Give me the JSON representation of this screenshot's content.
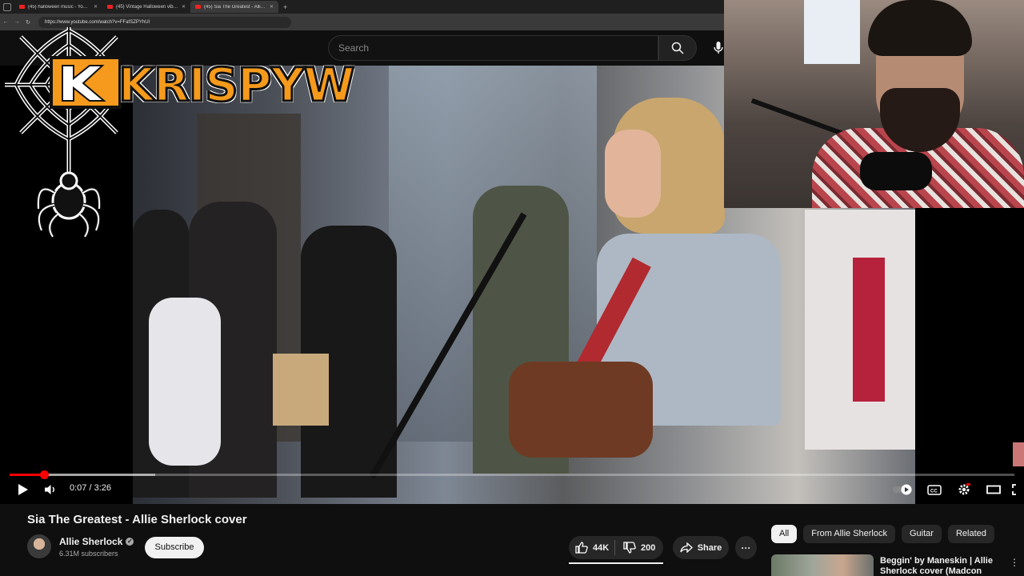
{
  "browser": {
    "tabs": [
      {
        "label": "(45) halloween music - YouTube",
        "active": false
      },
      {
        "label": "(45) Vintage Halloween vibes 🎃",
        "active": false
      },
      {
        "label": "(45) Sia The Greatest - Allie Sherl…",
        "active": true
      }
    ],
    "url": "https://www.youtube.com/watch?v=FFafSZPYhUI"
  },
  "header": {
    "search_placeholder": "Search"
  },
  "overlay": {
    "logo_text": "KRISPYW"
  },
  "player": {
    "time": "0:07 / 3:26",
    "played_fraction": 0.034,
    "buffered_fraction": 0.145
  },
  "video": {
    "title": "Sia The Greatest - Allie Sherlock cover",
    "channel": "Allie Sherlock",
    "subscribers": "6.31M subscribers",
    "subscribe_label": "Subscribe",
    "likes": "44K",
    "dislikes": "200",
    "share_label": "Share"
  },
  "sidebar": {
    "chips": [
      {
        "label": "All",
        "selected": true
      },
      {
        "label": "From Allie Sherlock",
        "selected": false
      },
      {
        "label": "Guitar",
        "selected": false
      },
      {
        "label": "Related",
        "selected": false
      }
    ],
    "recommendation": {
      "title": "Beggin' by Maneskin | Allie Sherlock cover (Madcon"
    }
  },
  "colors": {
    "accent": "#ff0000",
    "background": "#0f0f0f",
    "logo_orange": "#f59a1c"
  }
}
